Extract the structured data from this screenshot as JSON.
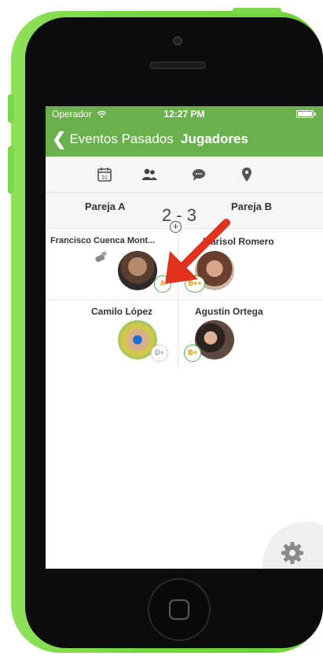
{
  "status_bar": {
    "carrier": "Operador",
    "time": "12:27 PM"
  },
  "nav": {
    "back_label": "Eventos Pasados",
    "title": "Jugadores"
  },
  "tabs": [
    {
      "icon": "calendar-icon",
      "label": "31"
    },
    {
      "icon": "players-icon"
    },
    {
      "icon": "chat-icon"
    },
    {
      "icon": "location-pin-icon"
    }
  ],
  "pairs": {
    "a_label": "Pareja A",
    "b_label": "Pareja B",
    "score_a": "2",
    "score_separator": "-",
    "score_b": "3",
    "add_icon": "plus-circle-icon"
  },
  "players": [
    {
      "name": "Francisco Cuenca Mont...",
      "level": "A",
      "team": "A"
    },
    {
      "name": "Marisol Romero",
      "level": "B++",
      "team": "B"
    },
    {
      "name": "Camilo López",
      "level": "D+",
      "team": "A"
    },
    {
      "name": "Agustin Ortega",
      "level": "B+",
      "team": "B"
    }
  ],
  "colors": {
    "nav_green": "#6ab04c",
    "phone_green": "#74d63e",
    "level_orange": "#f08a00",
    "arrow_red": "#e0321f"
  },
  "settings_icon": "gear-icon"
}
